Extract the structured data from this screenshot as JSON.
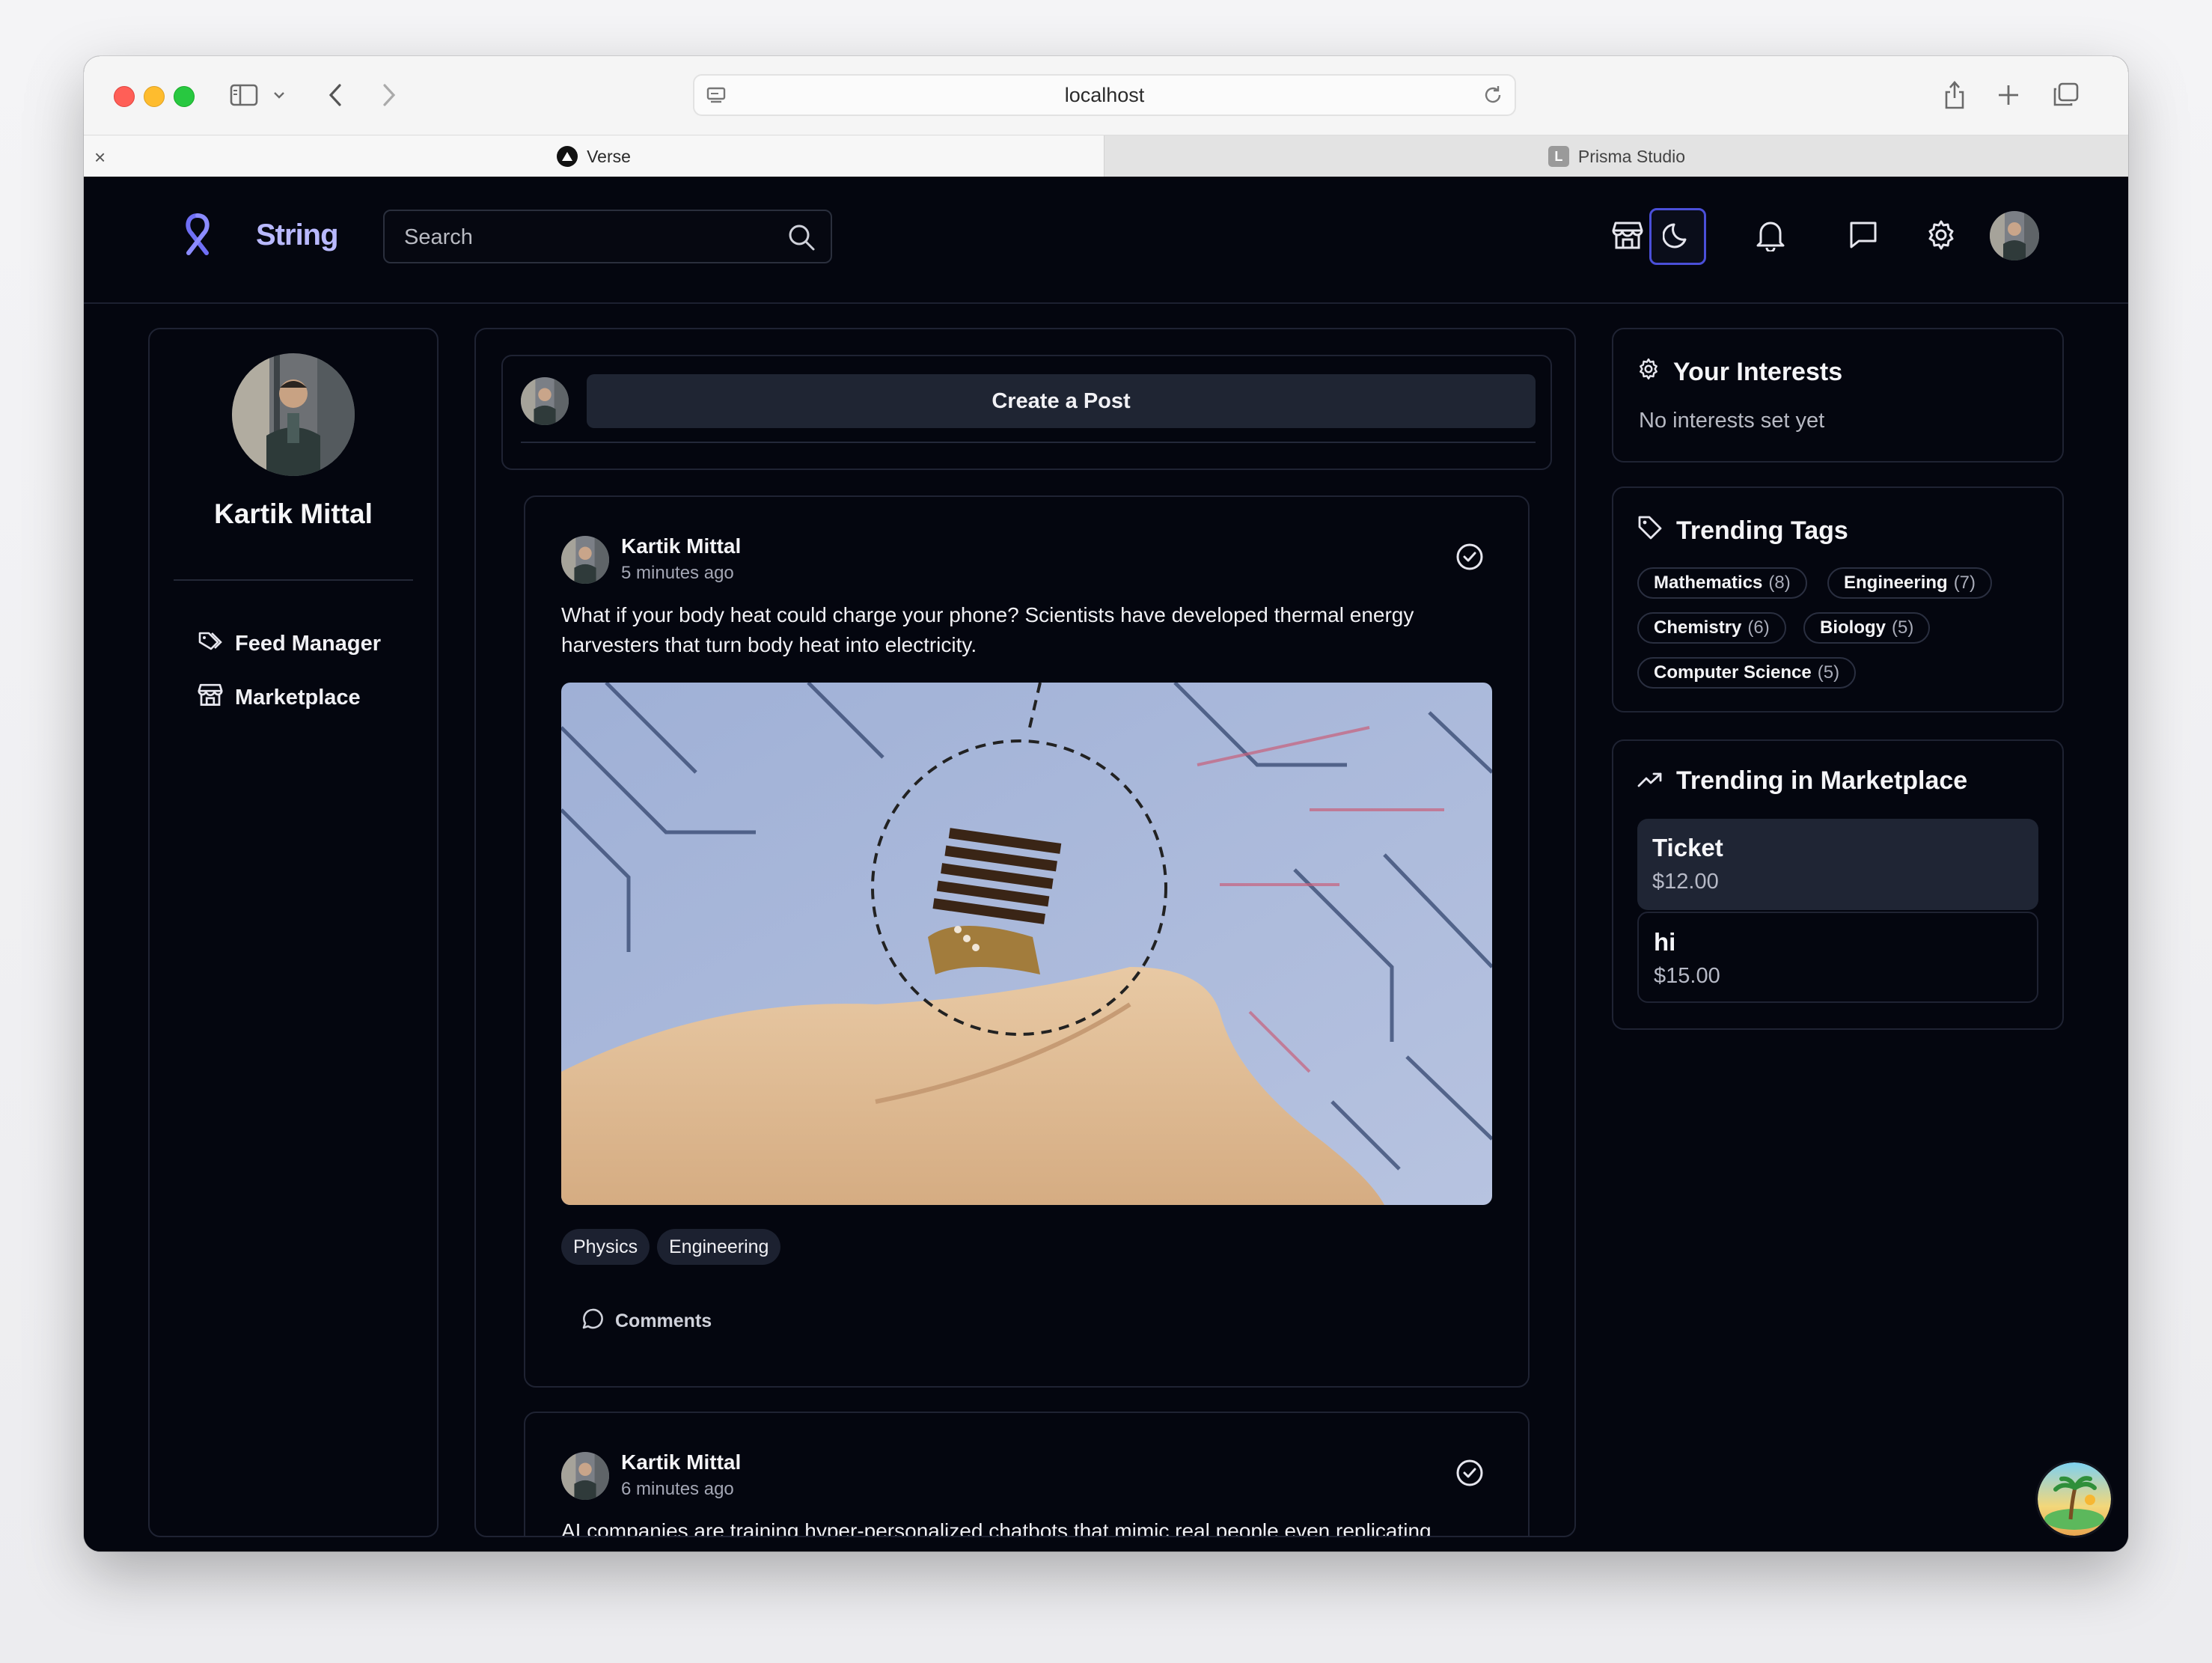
{
  "browser": {
    "url": "localhost",
    "tabs": [
      {
        "label": "Verse",
        "active": true
      },
      {
        "label": "Prisma Studio",
        "active": false,
        "favicon_letter": "L"
      }
    ]
  },
  "app": {
    "brand": "String",
    "accent_color": "#4a4fd8",
    "search_placeholder": "Search",
    "nav_icons": [
      "store-icon",
      "moon-icon",
      "bell-icon",
      "message-icon",
      "gear-icon",
      "avatar"
    ]
  },
  "sidebar": {
    "name": "Kartik Mittal",
    "items": [
      {
        "label": "Feed Manager",
        "icon": "tags-icon"
      },
      {
        "label": "Marketplace",
        "icon": "store-icon"
      }
    ]
  },
  "feed": {
    "create_label": "Create a Post",
    "posts": [
      {
        "author": "Kartik Mittal",
        "time": "5 minutes ago",
        "text": "What if your body heat could charge your phone? Scientists have developed thermal energy harvesters that turn body heat into electricity.",
        "tags": [
          "Physics",
          "Engineering"
        ],
        "comments_label": "Comments"
      },
      {
        "author": "Kartik Mittal",
        "time": "6 minutes ago",
        "text": "AI companies are training hyper-personalized chatbots that mimic real people even replicating"
      }
    ]
  },
  "interests": {
    "title": "Your Interests",
    "empty": "No interests set yet"
  },
  "trending_tags": {
    "title": "Trending Tags",
    "tags": [
      {
        "name": "Mathematics",
        "count": "(8)"
      },
      {
        "name": "Engineering",
        "count": "(7)"
      },
      {
        "name": "Chemistry",
        "count": "(6)"
      },
      {
        "name": "Biology",
        "count": "(5)"
      },
      {
        "name": "Computer Science",
        "count": "(5)"
      }
    ]
  },
  "marketplace": {
    "title": "Trending in Marketplace",
    "items": [
      {
        "name": "Ticket",
        "price": "$12.00"
      },
      {
        "name": "hi",
        "price": "$15.00"
      }
    ]
  }
}
